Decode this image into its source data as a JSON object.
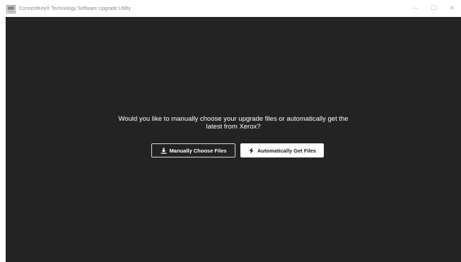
{
  "window": {
    "title": "ConnectKey® Technology Software Upgrade Utility",
    "controls": {
      "minimize": "—",
      "maximize": "☐",
      "close": "✕"
    }
  },
  "prompt": {
    "line1": "Would you like to manually choose your upgrade files or automatically get the",
    "line2": "latest from Xerox?"
  },
  "actions": {
    "manual": {
      "label": "Manually Choose Files",
      "icon": "download-icon"
    },
    "automatic": {
      "label": "Automatically Get Files",
      "icon": "lightning-bolt-icon"
    }
  },
  "colors": {
    "background": "#232323",
    "text": "#ffffff",
    "button_solid": "#ffffff",
    "button_border": "#d6d6d6"
  }
}
